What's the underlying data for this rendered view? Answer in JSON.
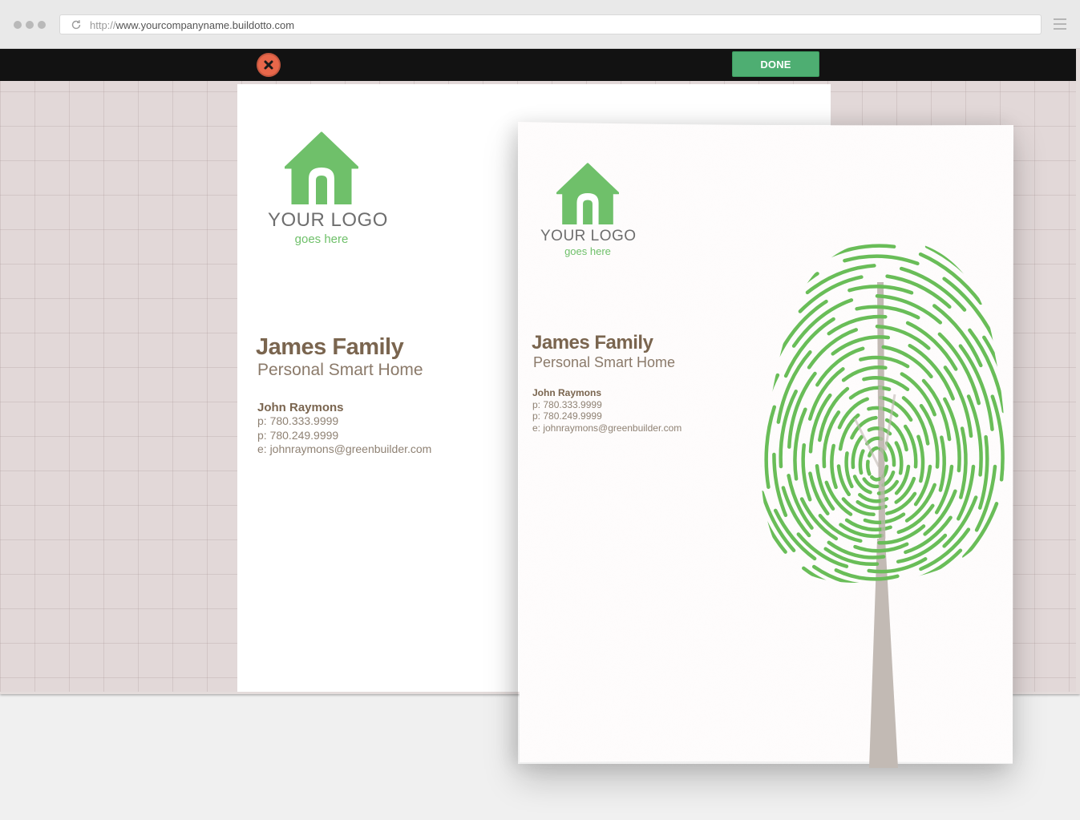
{
  "browser": {
    "url_protocol": "http://",
    "url_host": "www.yourcompanyname.buildotto.com"
  },
  "toolbar": {
    "done_label": "DONE"
  },
  "business_card": {
    "logo_text": "YOUR LOGO",
    "logo_sub": "goes here",
    "name": "James Family",
    "tagline": "Personal Smart Home",
    "person": "John Raymons",
    "phone1": "p: 780.333.9999",
    "phone2": "p: 780.249.9999",
    "email": "e: johnraymons@greenbuilder.com"
  },
  "letterhead": {
    "logo_text": "YOUR LOGO",
    "logo_sub": "goes here",
    "name": "James Family",
    "tagline": "Personal Smart Home",
    "person": "John Raymons",
    "phone1": "p: 780.333.9999",
    "phone2": "p: 780.249.9999",
    "email": "e: johnraymons@greenbuilder.com"
  },
  "colors": {
    "brand_green": "#6fc06a",
    "done_green": "#4eae72",
    "close_red": "#e8674a",
    "text_brown": "#7a654f"
  },
  "icons": [
    "reload-icon",
    "hamburger-menu-icon",
    "close-icon",
    "house-logo-icon",
    "fingerprint-tree-illustration"
  ]
}
